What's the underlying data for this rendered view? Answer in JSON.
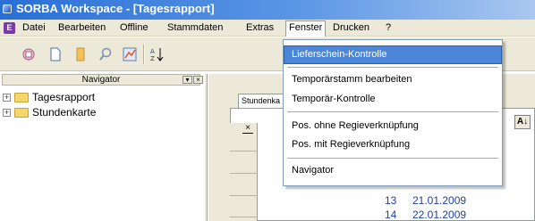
{
  "window": {
    "title": "SORBA Workspace - [Tagesrapport]"
  },
  "menubar": {
    "items": [
      {
        "label": "Datei"
      },
      {
        "label": "Bearbeiten"
      },
      {
        "label": "Offline"
      },
      {
        "label": "Stammdaten"
      },
      {
        "label": "Extras"
      },
      {
        "label": "Fenster"
      },
      {
        "label": "Drucken"
      },
      {
        "label": "?"
      }
    ],
    "active": "Fenster"
  },
  "toolbar": {
    "icons": [
      "new-entry-icon",
      "blank-page-icon",
      "folder-open-icon",
      "search-icon",
      "chart-icon",
      "sort-az-icon"
    ]
  },
  "navigator": {
    "title": "Navigator",
    "items": [
      {
        "label": "Tagesrapport"
      },
      {
        "label": "Stundenkarte"
      }
    ]
  },
  "main": {
    "tab_label": "Stundenka",
    "rows": [
      {
        "num": "13",
        "date": "21.01.2009"
      },
      {
        "num": "14",
        "date": "22.01.2009"
      }
    ]
  },
  "dropdown": {
    "items": [
      {
        "label": "Lieferschein-Kontrolle"
      },
      {
        "label": "Temporärstamm bearbeiten"
      },
      {
        "label": "Temporär-Kontrolle"
      },
      {
        "label": "Pos. ohne Regieverknüpfung"
      },
      {
        "label": "Pos. mit Regieverknüpfung"
      },
      {
        "label": "Navigator"
      }
    ],
    "selected": "Lieferschein-Kontrolle"
  },
  "colors": {
    "title_bar": "#2a6fd6",
    "selection": "#4b86d8",
    "row_text": "#1b3fa8"
  }
}
